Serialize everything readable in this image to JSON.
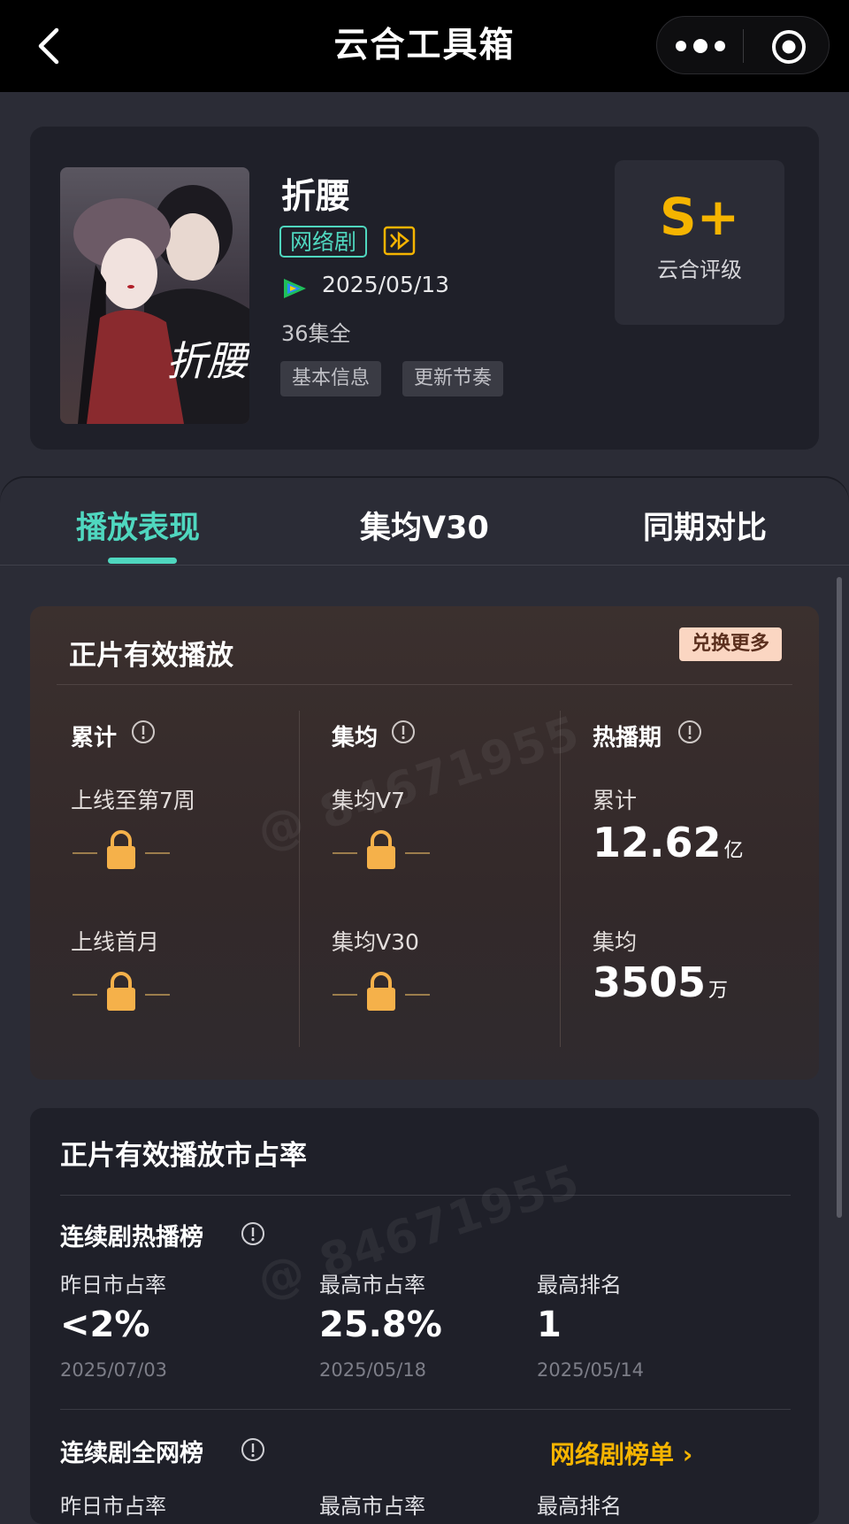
{
  "topbar": {
    "title": "云合工具箱"
  },
  "show": {
    "title": "折腰",
    "tag": "网络剧",
    "release_date": "2025/05/13",
    "episodes": "36集全",
    "chips": [
      "基本信息",
      "更新节奏"
    ],
    "rating_value": "S+",
    "rating_label": "云合评级",
    "poster_text": "折腰"
  },
  "tabs": [
    "播放表现",
    "集均V30",
    "同期对比"
  ],
  "play_card": {
    "title": "正片有效播放",
    "exchange_label": "兑换更多",
    "columns": [
      {
        "head": "累计",
        "items": [
          "上线至第7周",
          "上线首月"
        ]
      },
      {
        "head": "集均",
        "items": [
          "集均V7",
          "集均V30"
        ]
      },
      {
        "head": "热播期",
        "items": [
          "累计",
          "集均"
        ]
      }
    ],
    "hot": {
      "total_value": "12.62",
      "total_unit": "亿",
      "avg_value": "3505",
      "avg_unit": "万"
    }
  },
  "share_card": {
    "title": "正片有效播放市占率",
    "sections": [
      {
        "title": "连续剧热播榜",
        "stats": [
          {
            "label": "昨日市占率",
            "value": "<2%",
            "date": "2025/07/03"
          },
          {
            "label": "最高市占率",
            "value": "25.8%",
            "date": "2025/05/18"
          },
          {
            "label": "最高排名",
            "value": "1",
            "date": "2025/05/14"
          }
        ]
      },
      {
        "title": "连续剧全网榜",
        "link": "网络剧榜单 ›",
        "labels": [
          "昨日市占率",
          "最高市占率",
          "最高排名"
        ]
      }
    ]
  },
  "watermark": "@ 84671955",
  "colors": {
    "accent": "#4fd7bf",
    "gold": "#f5b400",
    "bg": "#2b2c36",
    "card": "#1f2029"
  }
}
